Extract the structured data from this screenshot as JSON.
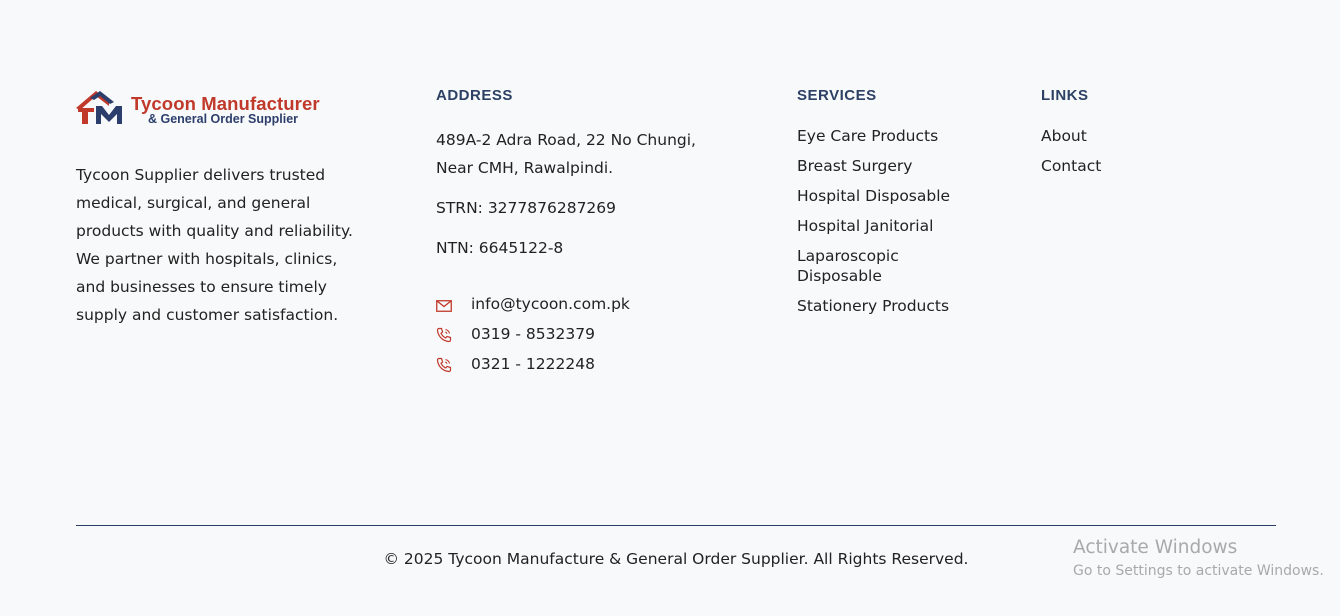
{
  "brand": {
    "name": "Tycoon Manufacturer",
    "tagline": "& General Order Supplier",
    "description": "Tycoon Supplier delivers trusted medical, surgical, and general products with quality and reliability. We partner with hospitals, clinics, and businesses to ensure timely supply and customer satisfaction.",
    "colors": {
      "red": "#c0392b",
      "navy": "#2c3e6b"
    }
  },
  "address": {
    "heading": "ADDRESS",
    "line1": "489A-2 Adra Road, 22 No Chungi,",
    "line2": "Near CMH, Rawalpindi.",
    "strn": "STRN: 3277876287269",
    "ntn": "NTN: 6645122-8",
    "contacts": [
      {
        "icon": "envelope-icon",
        "text": "info@tycoon.com.pk"
      },
      {
        "icon": "phone-icon",
        "text": "0319 - 8532379"
      },
      {
        "icon": "phone-icon",
        "text": "0321 - 1222248"
      }
    ]
  },
  "services": {
    "heading": "SERVICES",
    "items": [
      "Eye Care Products",
      "Breast Surgery",
      "Hospital Disposable",
      "Hospital Janitorial",
      "Laparoscopic Disposable",
      "Stationery Products"
    ]
  },
  "links": {
    "heading": "LINKS",
    "items": [
      "About",
      "Contact"
    ]
  },
  "copyright": "© 2025 Tycoon Manufacture & General Order Supplier. All Rights Reserved.",
  "os_watermark": {
    "title": "Activate Windows",
    "subtitle": "Go to Settings to activate Windows."
  }
}
